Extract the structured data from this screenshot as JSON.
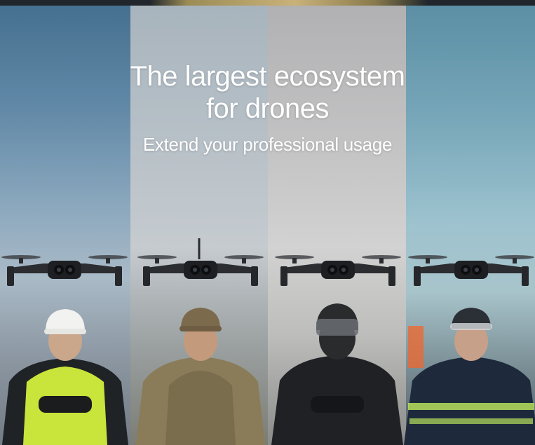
{
  "hero": {
    "title_line1": "The largest ecosystem",
    "title_line2": "for drones",
    "subtitle": "Extend your professional usage"
  },
  "panels": [
    {
      "role": "construction-worker",
      "bg": "#5f87a6",
      "helmet": "#f2f2f0",
      "vest": "#c9e43a"
    },
    {
      "role": "soldier",
      "bg": "#b7c0c7",
      "helmet": "#7c6a4c",
      "vest": "#8a7c58"
    },
    {
      "role": "tactical-officer",
      "bg": "#c2c2c3",
      "helmet": "#2a2b2d",
      "vest": "#1f2124"
    },
    {
      "role": "firefighter",
      "bg": "#76a6b8",
      "helmet": "#2b2f36",
      "vest": "#1e2a3c"
    }
  ]
}
